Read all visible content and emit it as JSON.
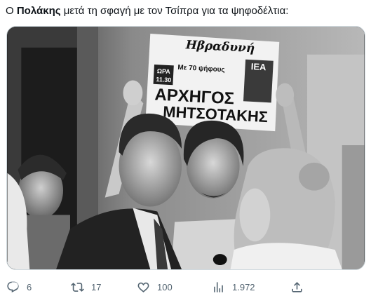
{
  "tweet": {
    "text_prefix": "Ο ",
    "text_bold": "Πολάκης",
    "text_suffix": " μετά τη σφαγή με τον Τσίπρα για τα ψηφοδέλτια:"
  },
  "media": {
    "newspaper_masthead": "Ηβραδυνή",
    "newspaper_subhead": "Με 70 ψήφους",
    "newspaper_time_label": "ΩΡΑ",
    "newspaper_time": "11.30",
    "newspaper_headline_1": "ΑΡΧΗΓΟΣ",
    "newspaper_headline_2": "ΜΗΤΣΟΤΑΚΗΣ",
    "newspaper_corner": "ΙΕΑ"
  },
  "actions": {
    "reply": {
      "icon": "reply-icon",
      "count": "6"
    },
    "retweet": {
      "icon": "retweet-icon",
      "count": "17"
    },
    "like": {
      "icon": "heart-icon",
      "count": "100"
    },
    "views": {
      "icon": "views-icon",
      "count": "1.972"
    },
    "share": {
      "icon": "share-icon",
      "count": ""
    }
  },
  "colors": {
    "text_primary": "#0f1419",
    "text_secondary": "#536471",
    "border": "#cfd9de"
  }
}
